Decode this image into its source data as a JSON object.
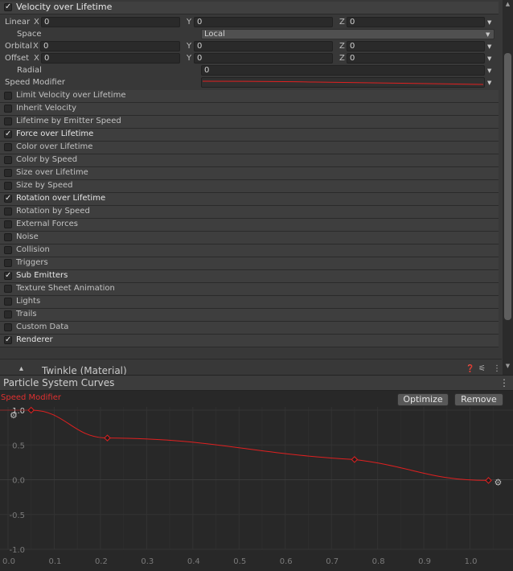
{
  "velocity_module": {
    "title": "Velocity over Lifetime",
    "enabled": true,
    "rows": {
      "linear": {
        "label": "Linear",
        "x_label": "X",
        "x": "0",
        "y_label": "Y",
        "y": "0",
        "z_label": "Z",
        "z": "0"
      },
      "space": {
        "label": "Space",
        "value": "Local"
      },
      "orbital": {
        "label": "Orbital",
        "x_label": "X",
        "x": "0",
        "y_label": "Y",
        "y": "0",
        "z_label": "Z",
        "z": "0"
      },
      "offset": {
        "label": "Offset",
        "x_label": "X",
        "x": "0",
        "y_label": "Y",
        "y": "0",
        "z_label": "Z",
        "z": "0"
      },
      "radial": {
        "label": "Radial",
        "value": "0"
      },
      "speed_modifier": {
        "label": "Speed Modifier"
      }
    }
  },
  "modules": [
    {
      "label": "Limit Velocity over Lifetime",
      "checked": false
    },
    {
      "label": "Inherit Velocity",
      "checked": false
    },
    {
      "label": "Lifetime by Emitter Speed",
      "checked": false
    },
    {
      "label": "Force over Lifetime",
      "checked": true
    },
    {
      "label": "Color over Lifetime",
      "checked": false
    },
    {
      "label": "Color by Speed",
      "checked": false
    },
    {
      "label": "Size over Lifetime",
      "checked": false
    },
    {
      "label": "Size by Speed",
      "checked": false
    },
    {
      "label": "Rotation over Lifetime",
      "checked": true
    },
    {
      "label": "Rotation by Speed",
      "checked": false
    },
    {
      "label": "External Forces",
      "checked": false
    },
    {
      "label": "Noise",
      "checked": false
    },
    {
      "label": "Collision",
      "checked": false
    },
    {
      "label": "Triggers",
      "checked": false
    },
    {
      "label": "Sub Emitters",
      "checked": true
    },
    {
      "label": "Texture Sheet Animation",
      "checked": false
    },
    {
      "label": "Lights",
      "checked": false
    },
    {
      "label": "Trails",
      "checked": false
    },
    {
      "label": "Custom Data",
      "checked": false
    },
    {
      "label": "Renderer",
      "checked": true
    }
  ],
  "material": {
    "label": "Twinkle (Material)"
  },
  "curves_window": {
    "title": "Particle System Curves",
    "optimize_label": "Optimize",
    "remove_label": "Remove",
    "curve_label": "Speed Modifier",
    "curve_color": "#e02020"
  },
  "chart_data": {
    "type": "line",
    "series": [
      {
        "name": "Speed Modifier",
        "keys": [
          [
            0.05,
            1.0
          ],
          [
            0.215,
            0.6
          ],
          [
            0.75,
            0.29
          ],
          [
            1.04,
            -0.01
          ]
        ]
      }
    ],
    "xticks": [
      "0.0",
      "0.1",
      "0.2",
      "0.3",
      "0.4",
      "0.5",
      "0.6",
      "0.7",
      "0.8",
      "0.9",
      "1.0"
    ],
    "yticks": [
      "1.0",
      "0.5",
      "0.0",
      "-0.5",
      "-1.0"
    ],
    "xlim": [
      0.0,
      1.06
    ],
    "ylim": [
      -1.0,
      1.0
    ],
    "grid": true
  }
}
